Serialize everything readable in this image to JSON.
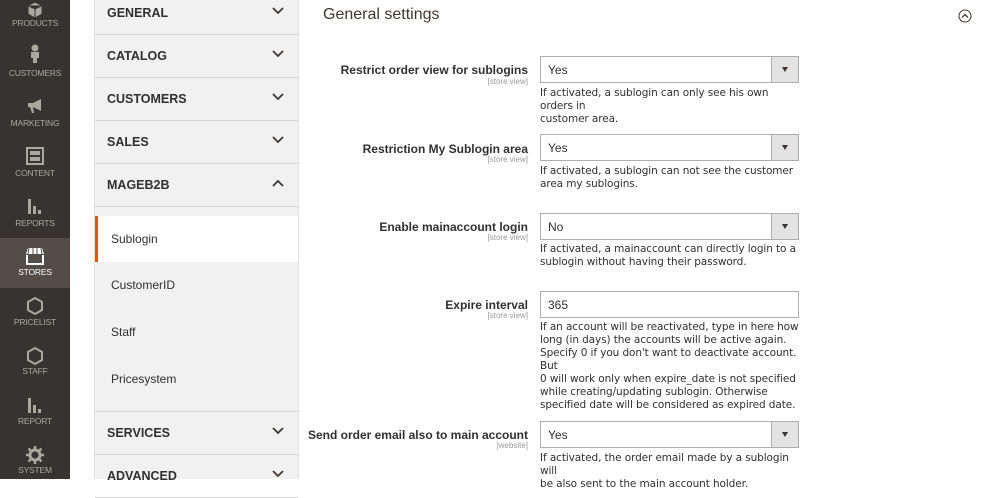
{
  "admin_nav": {
    "items": [
      {
        "label": "PRODUCTS",
        "icon": "cube-icon"
      },
      {
        "label": "CUSTOMERS",
        "icon": "person-icon"
      },
      {
        "label": "MARKETING",
        "icon": "megaphone-icon"
      },
      {
        "label": "CONTENT",
        "icon": "layout-icon"
      },
      {
        "label": "REPORTS",
        "icon": "bar-chart-icon"
      },
      {
        "label": "STORES",
        "icon": "store-icon",
        "active": true
      },
      {
        "label": "PRICELIST",
        "icon": "hexagon-icon"
      },
      {
        "label": "STAFF",
        "icon": "hexagon-icon"
      },
      {
        "label": "REPORT",
        "icon": "bar-chart-icon"
      },
      {
        "label": "SYSTEM",
        "icon": "gear-icon"
      }
    ]
  },
  "config_sidebar": {
    "groups": [
      {
        "label": "GENERAL"
      },
      {
        "label": "CATALOG"
      },
      {
        "label": "CUSTOMERS"
      },
      {
        "label": "SALES"
      },
      {
        "label": "MAGEB2B",
        "expanded": true
      },
      {
        "label": "SERVICES"
      },
      {
        "label": "ADVANCED"
      }
    ],
    "mageb2b_items": [
      {
        "label": "Sublogin",
        "active": true
      },
      {
        "label": "CustomerID"
      },
      {
        "label": "Staff"
      },
      {
        "label": "Pricesystem"
      }
    ]
  },
  "section": {
    "title": "General settings"
  },
  "fields": [
    {
      "label": "Restrict order view for sublogins",
      "scope": "[store view]",
      "type": "select",
      "value": "Yes",
      "note_lines": [
        "If activated, a sublogin can only see his own orders in",
        "customer area."
      ]
    },
    {
      "label": "Restriction My Sublogin area",
      "scope": "[store view]",
      "type": "select",
      "value": "Yes",
      "note_lines": [
        "If activated, a sublogin can not see the customer",
        "area my sublogins."
      ]
    },
    {
      "label": "Enable mainaccount login",
      "scope": "[store view]",
      "type": "select",
      "value": "No",
      "note_lines": [
        "If activated, a mainaccount can directly login to a",
        "sublogin without having their password."
      ]
    },
    {
      "label": "Expire interval",
      "scope": "[store view]",
      "type": "text",
      "value": "365",
      "note_lines": [
        "If an account will be reactivated, type in here how",
        "long (in days) the accounts will be active again.",
        "Specify 0 if you don't want to deactivate account. But",
        "0 will work only when expire_date is not specified",
        "while creating/updating sublogin. Otherwise",
        "specified date will be considered as expired date."
      ]
    },
    {
      "label": "Send order email also to main account",
      "scope": "[website]",
      "type": "select",
      "value": "Yes",
      "note_lines": [
        "If activated, the order email made by a sublogin will",
        "be also sent to the main account holder."
      ]
    }
  ],
  "colors": {
    "nav_bg": "#373330",
    "nav_active": "#524d49",
    "accent": "#eb5202",
    "sidebar_bg": "#f1f1f1"
  }
}
